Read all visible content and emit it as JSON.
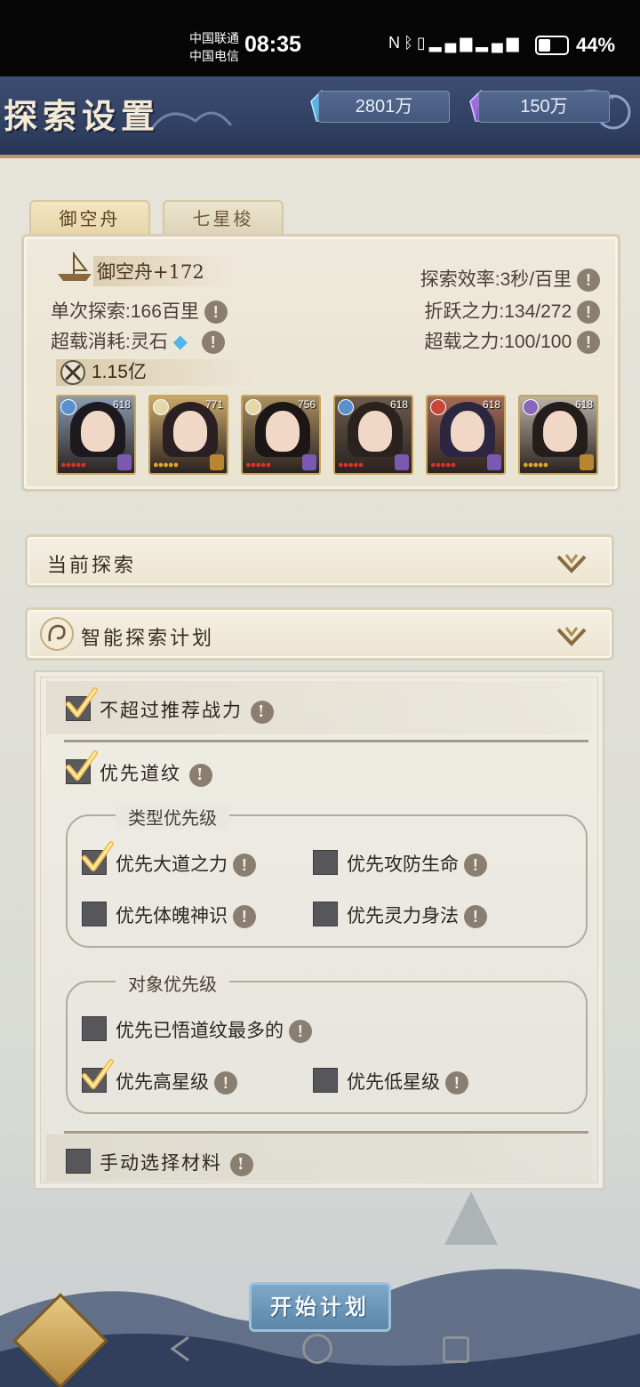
{
  "status_bar": {
    "carrier1": "中国联通",
    "carrier2": "中国电信",
    "time": "08:35",
    "icons": [
      "nfc-icon",
      "bluetooth-icon",
      "vibrate-icon",
      "5g-signal-icon",
      "4g-signal-icon"
    ],
    "battery_percent": "44%",
    "battery_level": 0.44
  },
  "header": {
    "title": "探索设置",
    "resource1": {
      "icon": "blue-crystal-icon",
      "value": "2801万"
    },
    "resource2": {
      "icon": "purple-crystal-icon",
      "value": "150万"
    }
  },
  "tabs": [
    {
      "label": "御空舟",
      "active": true
    },
    {
      "label": "七星梭",
      "active": false
    }
  ],
  "ship": {
    "icon": "ship-icon",
    "name": "御空舟+172",
    "single_explore": "单次探索:166百里",
    "overload_cost": "超载消耗:灵石",
    "efficiency": "探索效率:3秒/百里",
    "jump_power": "折跃之力:134/272",
    "overload_power": "超载之力:100/100",
    "combat_power": "1.15亿"
  },
  "heroes": [
    {
      "level": "618",
      "element": "#5a8fd0",
      "bg": "#8a9bb0",
      "hair": "#1c1a1e",
      "star_color": "#d8332a"
    },
    {
      "level": "771",
      "element": "#e6d7a8",
      "bg": "#c9a86a",
      "hair": "#2a1f22",
      "star_color": "#e0a52b"
    },
    {
      "level": "756",
      "element": "#e6d7a8",
      "bg": "#a88f60",
      "hair": "#1c1617",
      "star_color": "#d8332a"
    },
    {
      "level": "618",
      "element": "#5a8fd0",
      "bg": "#6b5b4b",
      "hair": "#2a221e",
      "star_color": "#d8332a"
    },
    {
      "level": "618",
      "element": "#c9453a",
      "bg": "#a36a55",
      "hair": "#2c2640",
      "star_color": "#d8332a"
    },
    {
      "level": "618",
      "element": "#8a66b8",
      "bg": "#b9b2a6",
      "hair": "#231d1b",
      "star_color": "#e0a52b"
    }
  ],
  "sections": {
    "current": "当前探索",
    "plan": "智能探索计划"
  },
  "options": {
    "no_exceed": {
      "label": "不超过推荐战力",
      "checked": true
    },
    "prefer_pattern": {
      "label": "优先道纹",
      "checked": true
    },
    "type_group": {
      "title": "类型优先级",
      "items": [
        {
          "label": "优先大道之力",
          "checked": true
        },
        {
          "label": "优先攻防生命",
          "checked": false
        },
        {
          "label": "优先体魄神识",
          "checked": false
        },
        {
          "label": "优先灵力身法",
          "checked": false
        }
      ]
    },
    "target_group": {
      "title": "对象优先级",
      "items": [
        {
          "label": "优先已悟道纹最多的",
          "checked": false
        },
        {
          "label": "优先高星级",
          "checked": true
        },
        {
          "label": "优先低星级",
          "checked": false
        }
      ]
    },
    "manual": {
      "label": "手动选择材料",
      "checked": false
    }
  },
  "start_button": "开始计划",
  "info_glyph": "!"
}
